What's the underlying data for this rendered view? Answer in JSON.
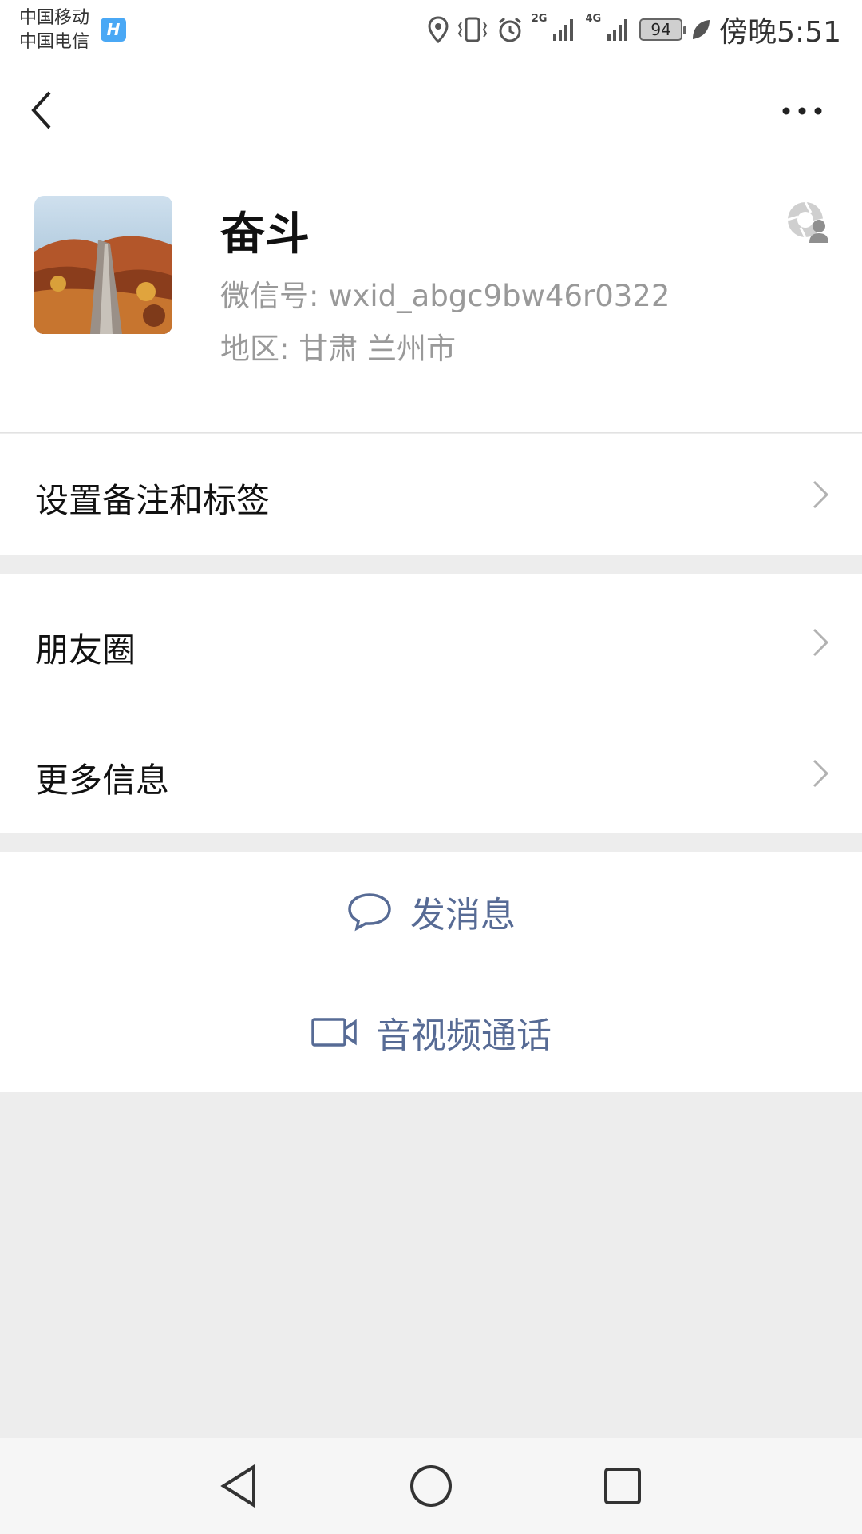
{
  "status_bar": {
    "carrier1": "中国移动",
    "carrier2": "中国电信",
    "hd_badge": "H",
    "network1": "2G",
    "network2": "4G",
    "battery": "94",
    "time": "傍晚5:51"
  },
  "profile": {
    "name": "奋斗",
    "wxid": "微信号:  wxid_abgc9bw46r0322",
    "region": "地区:  甘肃  兰州市"
  },
  "rows": {
    "remark_label": "设置备注和标签",
    "moments_label": "朋友圈",
    "more_info_label": "更多信息"
  },
  "actions": {
    "message_label": "发消息",
    "call_label": "音视频通话"
  },
  "colors": {
    "accent": "#576b95",
    "background": "#ededed",
    "hd_badge": "#4aa8f5"
  },
  "icons": {
    "back": "back-arrow-icon",
    "more": "more-dots-icon",
    "chat": "chat-bubble-icon",
    "video": "video-camera-icon",
    "moments": "moments-camera-icon",
    "chevron": "chevron-right-icon"
  }
}
